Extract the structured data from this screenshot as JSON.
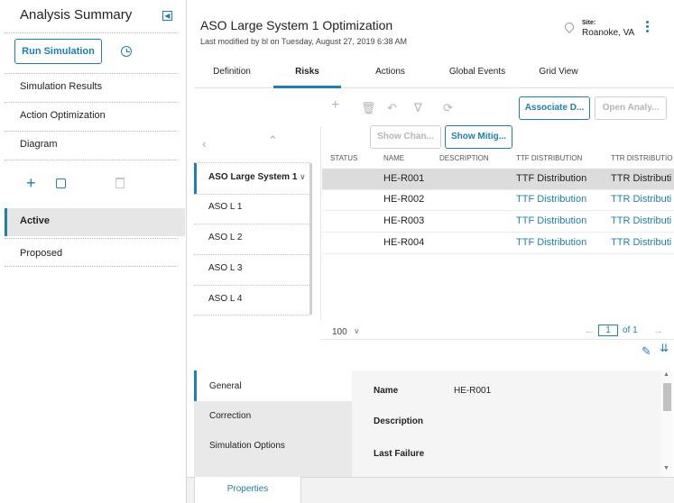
{
  "sidebar": {
    "title": "Analysis Summary",
    "run_button": "Run Simulation",
    "nav_items": [
      "Simulation Results",
      "Action Optimization",
      "Diagram"
    ],
    "scenarios": {
      "active": "Active",
      "proposed": "Proposed"
    }
  },
  "header": {
    "title": "ASO Large System 1 Optimization",
    "subtitle": "Last modified by bl on Tuesday, August 27, 2019 6:38 AM",
    "site_label": "Site:",
    "site_value": "Roanoke, VA"
  },
  "tabs": [
    {
      "label": "Definition",
      "active": false
    },
    {
      "label": "Risks",
      "active": true
    },
    {
      "label": "Actions",
      "active": false
    },
    {
      "label": "Global Events",
      "active": false
    },
    {
      "label": "Grid View",
      "active": false
    }
  ],
  "toolbar": {
    "associate": "Associate D...",
    "open_analysis": "Open Analy...",
    "show_changes": "Show Chan...",
    "show_mitigations": "Show Mitig..."
  },
  "tree": {
    "selected": "ASO Large System 1",
    "items": [
      "ASO L 1",
      "ASO L 2",
      "ASO L 3",
      "ASO L 4"
    ]
  },
  "grid": {
    "columns": [
      "STATUS",
      "NAME",
      "DESCRIPTION",
      "TTF DISTRIBUTION",
      "TTR DISTRIBUTIO"
    ],
    "rows": [
      {
        "name": "HE-R001",
        "ttf": "TTF Distribution",
        "ttr": "TTR Distributi"
      },
      {
        "name": "HE-R002",
        "ttf": "TTF Distribution",
        "ttr": "TTR Distributi"
      },
      {
        "name": "HE-R003",
        "ttf": "TTF Distribution",
        "ttr": "TTR Distributi"
      },
      {
        "name": "HE-R004",
        "ttf": "TTF Distribution",
        "ttr": "TTR Distributi"
      }
    ]
  },
  "pager": {
    "page_size": "100",
    "current_page": "1",
    "of_label": "of 1"
  },
  "details": {
    "tabs": [
      "General",
      "Correction",
      "Simulation Options"
    ],
    "fields": [
      {
        "label": "Name",
        "value": "HE-R001"
      },
      {
        "label": "Description",
        "value": ""
      },
      {
        "label": "Last Failure",
        "value": ""
      }
    ]
  },
  "footer": {
    "tab": "Properties"
  },
  "colors": {
    "accent": "#1d7fb3",
    "selected_row": "#dcdcdc"
  }
}
